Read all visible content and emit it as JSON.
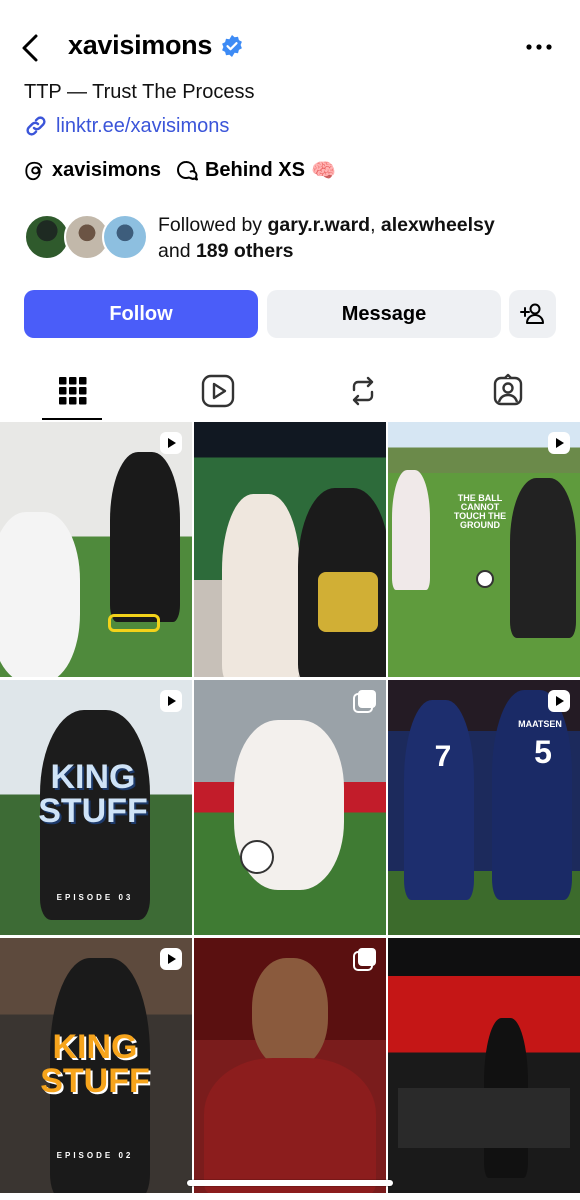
{
  "header": {
    "username": "xavisimons",
    "verified": true,
    "back_icon": "chevron-left-icon",
    "more_icon": "more-horizontal-icon"
  },
  "profile": {
    "bio": "TTP — Trust The Process",
    "link": "linktr.ee/xavisimons",
    "threads_handle": "xavisimons",
    "channel_name": "Behind XS",
    "channel_emoji": "🧠",
    "followed_by_prefix": "Followed by ",
    "followed_by_user1": "gary.r.ward",
    "followed_by_sep": ", ",
    "followed_by_user2": "alexwheelsy",
    "followed_by_and": "and ",
    "followed_by_others": "189 others"
  },
  "actions": {
    "follow_label": "Follow",
    "message_label": "Message",
    "add_user_icon": "add-user-icon"
  },
  "tabs": [
    {
      "name": "grid",
      "icon": "grid-icon",
      "active": true
    },
    {
      "name": "reels",
      "icon": "reels-icon",
      "active": false
    },
    {
      "name": "reposts",
      "icon": "repost-icon",
      "active": false
    },
    {
      "name": "tagged",
      "icon": "tagged-icon",
      "active": false
    }
  ],
  "posts": {
    "p3_text": "THE BALL CANNOT TOUCH THE GROUND",
    "p4_title": "KING STUFF",
    "p4_episode": "EPISODE 03",
    "p6_name": "MAATSEN",
    "p6_num1": "7",
    "p6_num2": "5",
    "p7_title": "KING STUFF",
    "p7_episode": "EPISODE 02"
  },
  "colors": {
    "follow_button": "#4a5df9",
    "link": "#3b55d9",
    "secondary_button": "#eef0f3"
  }
}
